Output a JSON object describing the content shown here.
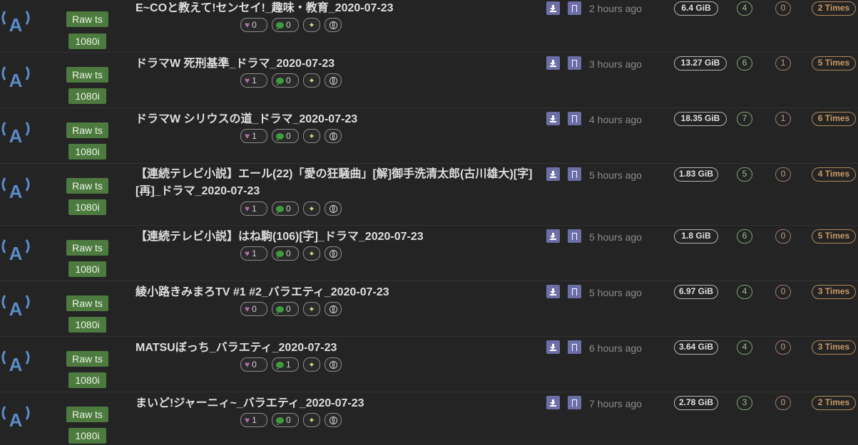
{
  "torrents": [
    {
      "title": "E~COと教えて!センセイ!_趣味・教育_2020-07-23",
      "format": "Raw ts",
      "resolution": "1080i",
      "likes": "0",
      "comments": "0",
      "time": "2 hours ago",
      "size": "6.4 GiB",
      "seeders": "4",
      "leechers": "0",
      "completed": "2 Times"
    },
    {
      "title": "ドラマW 死刑基準_ドラマ_2020-07-23",
      "format": "Raw ts",
      "resolution": "1080i",
      "likes": "1",
      "comments": "0",
      "time": "3 hours ago",
      "size": "13.27 GiB",
      "seeders": "6",
      "leechers": "1",
      "completed": "5 Times"
    },
    {
      "title": "ドラマW シリウスの道_ドラマ_2020-07-23",
      "format": "Raw ts",
      "resolution": "1080i",
      "likes": "1",
      "comments": "0",
      "time": "4 hours ago",
      "size": "18.35 GiB",
      "seeders": "7",
      "leechers": "1",
      "completed": "6 Times"
    },
    {
      "title": "【連続テレビ小説】エール(22)「愛の狂騒曲」[解]御手洗清太郎(古川雄大)[字][再]_ドラマ_2020-07-23",
      "format": "Raw ts",
      "resolution": "1080i",
      "likes": "1",
      "comments": "0",
      "time": "5 hours ago",
      "size": "1.83 GiB",
      "seeders": "5",
      "leechers": "0",
      "completed": "4 Times"
    },
    {
      "title": "【連続テレビ小説】はね駒(106)[字]_ドラマ_2020-07-23",
      "format": "Raw ts",
      "resolution": "1080i",
      "likes": "1",
      "comments": "0",
      "time": "5 hours ago",
      "size": "1.8 GiB",
      "seeders": "6",
      "leechers": "0",
      "completed": "5 Times"
    },
    {
      "title": "綾小路きみまろTV #1 #2_バラエティ_2020-07-23",
      "format": "Raw ts",
      "resolution": "1080i",
      "likes": "0",
      "comments": "0",
      "time": "5 hours ago",
      "size": "6.97 GiB",
      "seeders": "4",
      "leechers": "0",
      "completed": "3 Times"
    },
    {
      "title": "MATSUぼっち_バラエティ_2020-07-23",
      "format": "Raw ts",
      "resolution": "1080i",
      "likes": "0",
      "comments": "1",
      "time": "6 hours ago",
      "size": "3.64 GiB",
      "seeders": "4",
      "leechers": "0",
      "completed": "3 Times"
    },
    {
      "title": "まいど!ジャーニィ~_バラエティ_2020-07-23",
      "format": "Raw ts",
      "resolution": "1080i",
      "likes": "1",
      "comments": "0",
      "time": "7 hours ago",
      "size": "2.78 GiB",
      "seeders": "3",
      "leechers": "0",
      "completed": "2 Times"
    }
  ],
  "icons": {
    "category": "broadcast-antenna-icon",
    "like": "heart-icon",
    "comment": "comment-bubble-icon",
    "magic": "magic-wand-icon",
    "web": "globe-icon",
    "download": "download-icon",
    "bookmark": "bookmark-icon"
  },
  "colors": {
    "background": "#242424",
    "tag": "#4d7a3f",
    "action_button": "#6c6fa7",
    "seeders": "#96c286",
    "leechers": "#c89888",
    "completed": "#c89a66"
  }
}
